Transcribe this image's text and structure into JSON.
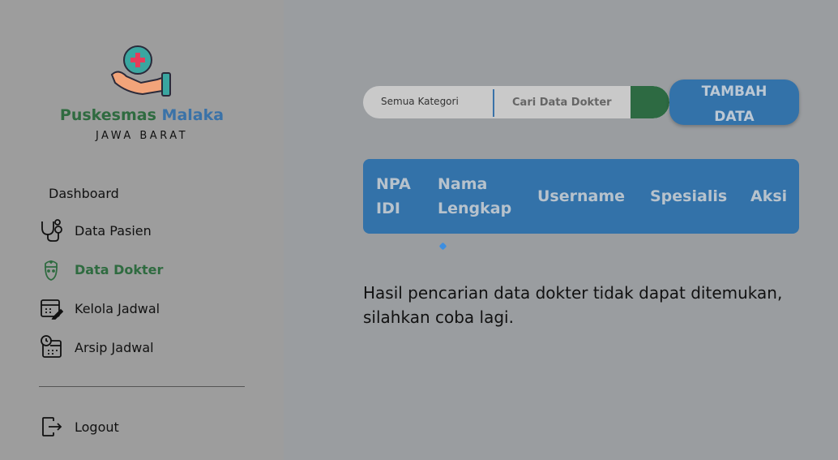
{
  "sidebar": {
    "brand_part1": "Puskesmas",
    "brand_part2": "Malaka",
    "subbrand": "JAWA BARAT",
    "dashboard": "Dashboard",
    "items": [
      {
        "label": "Data Pasien",
        "icon": "stethoscope-icon"
      },
      {
        "label": "Data Dokter",
        "icon": "doctor-icon",
        "active": true
      },
      {
        "label": "Kelola Jadwal",
        "icon": "calendar-edit-icon"
      },
      {
        "label": "Arsip Jadwal",
        "icon": "calendar-clock-icon"
      }
    ],
    "logout": "Logout"
  },
  "search": {
    "category": "Semua Kategori",
    "placeholder": "Cari Data Dokter"
  },
  "add_button": {
    "line1": "TAMBAH",
    "line2": "DATA"
  },
  "table": {
    "headers": [
      {
        "l1": "NPA",
        "l2": "IDI"
      },
      {
        "l1": "Nama",
        "l2": "Lengkap"
      },
      {
        "l1": "Username"
      },
      {
        "l1": "Spesialis"
      },
      {
        "l1": "Aksi"
      }
    ]
  },
  "message": "Hasil pencarian data dokter tidak dapat ditemukan, silahkan coba lagi.",
  "colors": {
    "primary": "#3372a9",
    "green": "#2d6a42"
  }
}
